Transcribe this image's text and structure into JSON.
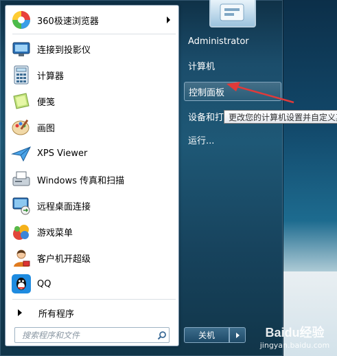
{
  "left_panel": {
    "items": [
      {
        "label": "360极速浏览器",
        "icon": "browser-360-icon",
        "has_submenu": true
      },
      {
        "label": "连接到投影仪",
        "icon": "projector-icon"
      },
      {
        "label": "计算器",
        "icon": "calculator-icon"
      },
      {
        "label": "便笺",
        "icon": "sticky-notes-icon"
      },
      {
        "label": "画图",
        "icon": "paint-icon"
      },
      {
        "label": "XPS Viewer",
        "icon": "xps-viewer-icon"
      },
      {
        "label": "Windows 传真和扫描",
        "icon": "fax-scan-icon"
      },
      {
        "label": "远程桌面连接",
        "icon": "remote-desktop-icon"
      },
      {
        "label": "游戏菜单",
        "icon": "games-icon"
      },
      {
        "label": "客户机开超级",
        "icon": "user-client-icon"
      },
      {
        "label": "QQ",
        "icon": "qq-icon"
      }
    ],
    "all_programs": "所有程序",
    "search_placeholder": "搜索程序和文件"
  },
  "right_panel": {
    "items": [
      {
        "label": "Administrator"
      },
      {
        "label": "计算机"
      },
      {
        "label": "控制面板",
        "highlighted": true
      },
      {
        "label": "设备和打印机"
      },
      {
        "label": "运行..."
      }
    ],
    "shutdown_label": "关机"
  },
  "tooltip": "更改您的计算机设置并自定义其功能。",
  "watermark": {
    "line1": "Baidu经验",
    "line2": "jingyan.baidu.com"
  },
  "colors": {
    "annotation": "#e03a3a",
    "menu_bg": "#1b4d6b"
  }
}
